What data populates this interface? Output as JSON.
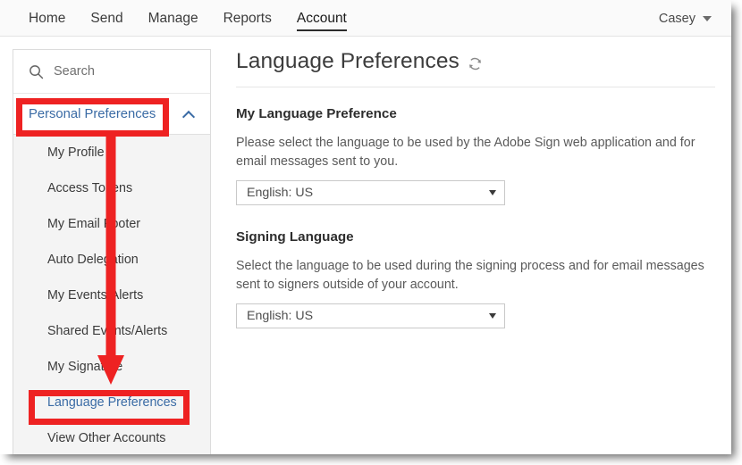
{
  "top_nav": {
    "tabs": [
      {
        "label": "Home",
        "active": false
      },
      {
        "label": "Send",
        "active": false
      },
      {
        "label": "Manage",
        "active": false
      },
      {
        "label": "Reports",
        "active": false
      },
      {
        "label": "Account",
        "active": true
      }
    ],
    "user": {
      "name": "Casey",
      "caret_icon": "chevron-down-icon"
    }
  },
  "sidebar": {
    "search": {
      "icon": "search-icon",
      "placeholder": "Search",
      "value": ""
    },
    "section": {
      "title": "Personal Preferences",
      "expanded": true,
      "toggle_icon": "chevron-up-icon"
    },
    "items": [
      {
        "label": "My Profile",
        "selected": false
      },
      {
        "label": "Access Tokens",
        "selected": false
      },
      {
        "label": "My Email Footer",
        "selected": false
      },
      {
        "label": "Auto Delegation",
        "selected": false
      },
      {
        "label": "My Events/Alerts",
        "selected": false
      },
      {
        "label": "Shared Events/Alerts",
        "selected": false
      },
      {
        "label": "My Signature",
        "selected": false
      },
      {
        "label": "Language Preferences",
        "selected": true
      },
      {
        "label": "View Other Accounts",
        "selected": false
      }
    ]
  },
  "main": {
    "title": "Language Preferences",
    "refresh_icon": "refresh-icon",
    "sections": [
      {
        "heading": "My Language Preference",
        "description": "Please select the language to be used by the Adobe Sign web application and for email messages sent to you.",
        "select": {
          "value": "English: US",
          "caret_icon": "chevron-down-icon"
        }
      },
      {
        "heading": "Signing Language",
        "description": "Select the language to be used during the signing process and for email messages sent to signers outside of your account.",
        "select": {
          "value": "English: US",
          "caret_icon": "chevron-down-icon"
        }
      }
    ]
  },
  "annotations": {
    "color": "#ee2222",
    "highlight_boxes": [
      {
        "target": "Personal Preferences"
      },
      {
        "target": "Language Preferences"
      }
    ],
    "arrow": {
      "from": "Personal Preferences",
      "to": "Language Preferences",
      "direction": "down"
    }
  },
  "colors": {
    "link_blue": "#3a6ba5",
    "annotation_red": "#ee2222",
    "nav_background": "#fafafa",
    "submenu_background": "#f4f4f4"
  }
}
